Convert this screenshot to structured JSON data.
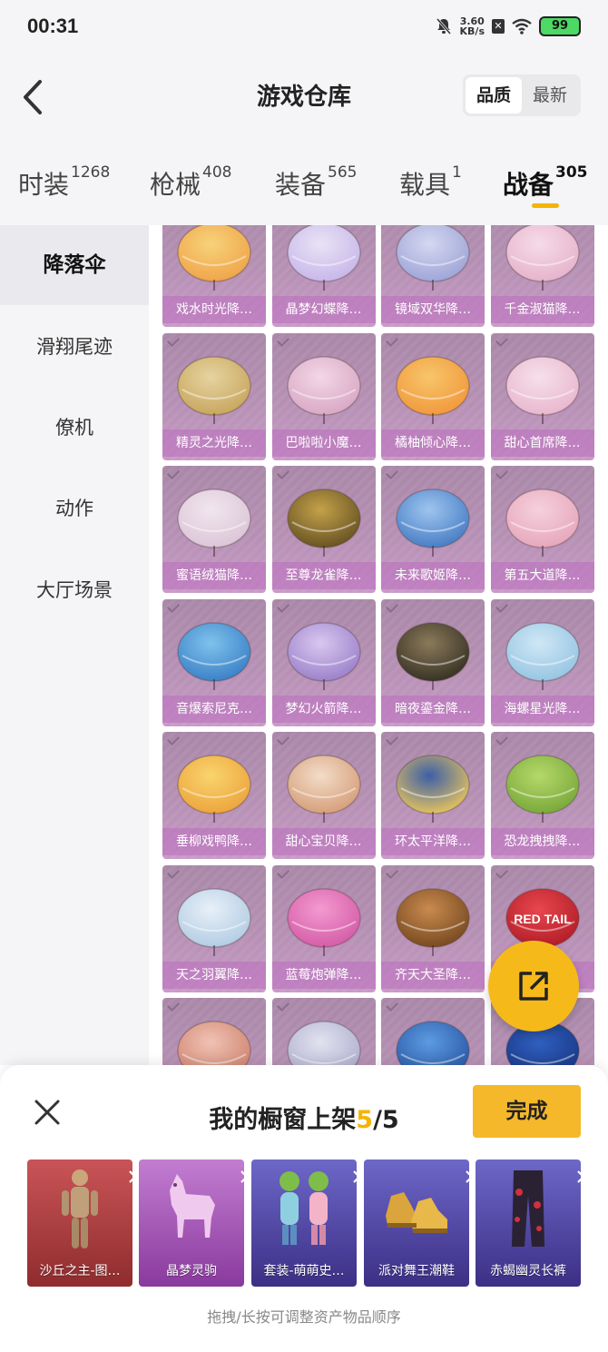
{
  "status_bar": {
    "time": "00:31",
    "net_speed_value": "3.60",
    "net_speed_unit": "KB/s",
    "battery": "99"
  },
  "header": {
    "title": "游戏仓库",
    "sort_options": [
      "品质",
      "最新"
    ],
    "active_sort": "品质"
  },
  "category_tabs": [
    {
      "label": "时装",
      "count": "1268"
    },
    {
      "label": "枪械",
      "count": "408"
    },
    {
      "label": "装备",
      "count": "565"
    },
    {
      "label": "载具",
      "count": "1"
    },
    {
      "label": "战备",
      "count": "305",
      "active": true
    }
  ],
  "sidebar": {
    "items": [
      "降落伞",
      "滑翔尾迹",
      "僚机",
      "动作",
      "大厅场景"
    ],
    "active": "降落伞"
  },
  "grid": {
    "items": [
      "戏水时光降…",
      "晶梦幻蝶降…",
      "镜域双华降…",
      "千金淑猫降…",
      "精灵之光降…",
      "巴啦啦小魔…",
      "橘柚倾心降…",
      "甜心首席降…",
      "蜜语绒猫降…",
      "至尊龙雀降…",
      "未来歌姬降…",
      "第五大道降…",
      "音爆索尼克…",
      "梦幻火箭降…",
      "暗夜鎏金降…",
      "海螺星光降…",
      "垂柳戏鸭降…",
      "甜心宝贝降…",
      "环太平洋降…",
      "恐龙拽拽降…",
      "天之羽翼降…",
      "蓝莓炮弹降…",
      "齐天大圣降…",
      "",
      "",
      "",
      "",
      ""
    ],
    "partial_text": "RED TAIL"
  },
  "showcase": {
    "title_prefix": "我的橱窗上架",
    "current": "5",
    "separator_total": "/5",
    "done_label": "完成",
    "items": [
      "沙丘之主-图…",
      "晶梦灵驹",
      "套装-萌萌史…",
      "派对舞王潮鞋",
      "赤蝎幽灵长裤"
    ],
    "hint": "拖拽/长按可调整资产物品顺序"
  },
  "colors": {
    "accent": "#f5b400",
    "card_bg": "#b690b4",
    "button_yellow": "#f5b82b"
  }
}
